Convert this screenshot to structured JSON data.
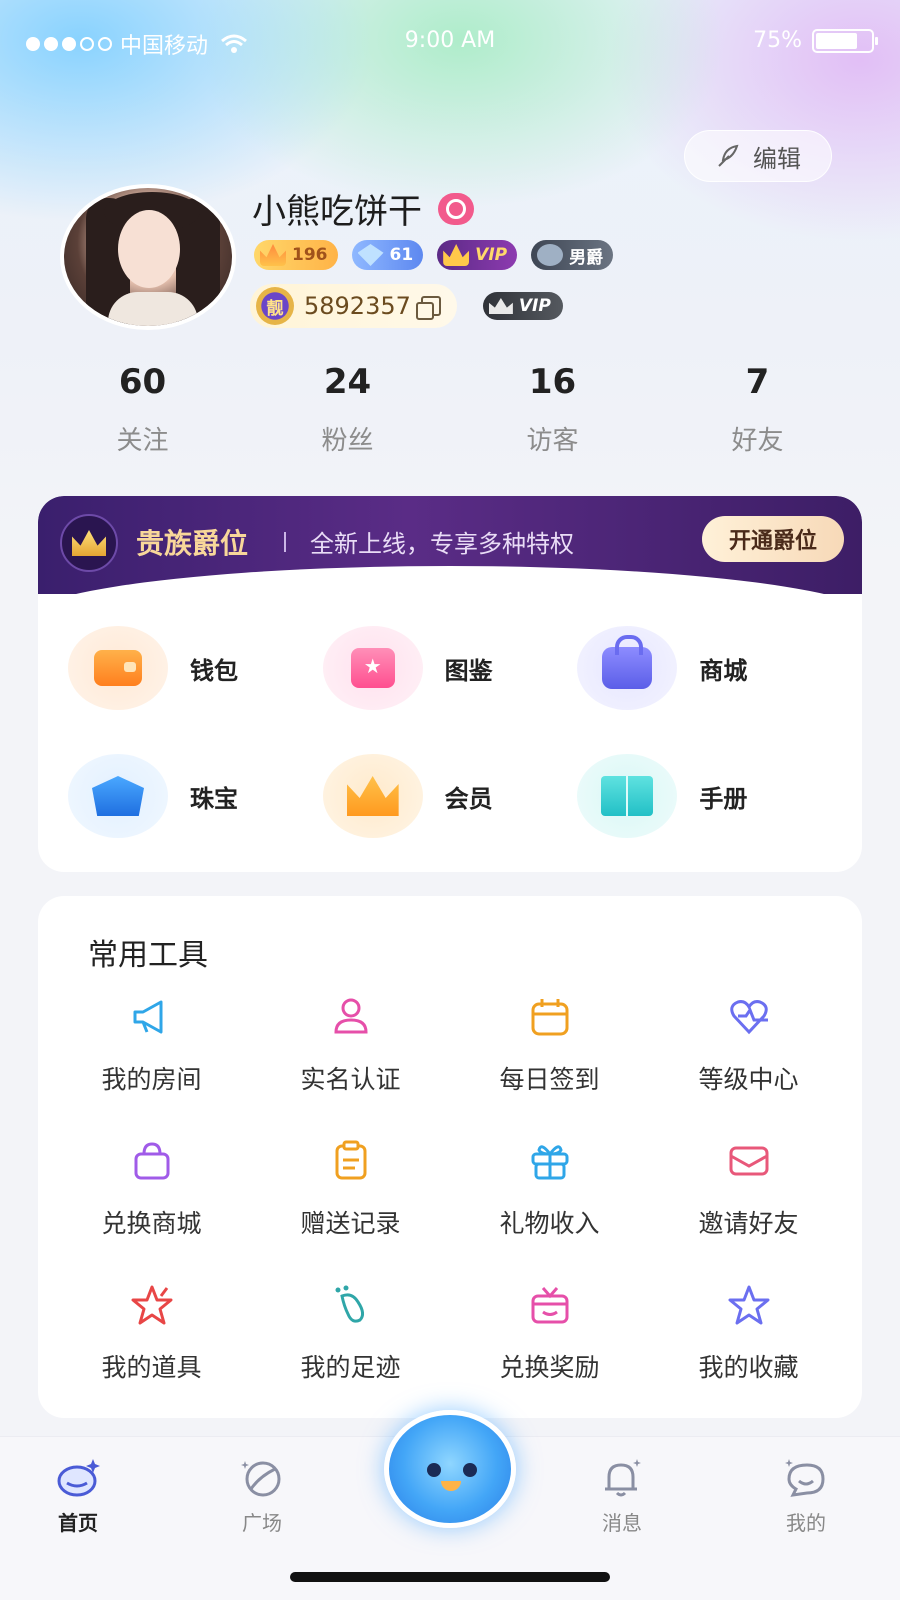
{
  "status_bar": {
    "carrier": "中国移动",
    "time": "9:00 AM",
    "battery": "75%"
  },
  "profile": {
    "edit_label": "编辑",
    "username": "小熊吃饼干",
    "badges": {
      "level": "196",
      "diamond": "61",
      "vip": "VIP",
      "noble": "男爵"
    },
    "id": "5892357",
    "liang_label": "靓",
    "vip2": "VIP"
  },
  "stats": [
    {
      "num": "60",
      "label": "关注"
    },
    {
      "num": "24",
      "label": "粉丝"
    },
    {
      "num": "16",
      "label": "访客"
    },
    {
      "num": "7",
      "label": "好友"
    }
  ],
  "noble": {
    "title": "贵族爵位",
    "subtitle": "全新上线，专享多种特权",
    "button": "开通爵位",
    "items": [
      {
        "label": "钱包",
        "icon": "wallet-icon"
      },
      {
        "label": "图鉴",
        "icon": "gift-box-icon"
      },
      {
        "label": "商城",
        "icon": "shopping-bag-icon"
      },
      {
        "label": "珠宝",
        "icon": "shell-icon"
      },
      {
        "label": "会员",
        "icon": "crown-icon"
      },
      {
        "label": "手册",
        "icon": "book-icon"
      }
    ]
  },
  "tools": {
    "title": "常用工具",
    "items": [
      {
        "label": "我的房间",
        "icon": "megaphone-icon"
      },
      {
        "label": "实名认证",
        "icon": "person-icon"
      },
      {
        "label": "每日签到",
        "icon": "calendar-icon"
      },
      {
        "label": "等级中心",
        "icon": "heart-pulse-icon"
      },
      {
        "label": "兑换商城",
        "icon": "bag-icon"
      },
      {
        "label": "赠送记录",
        "icon": "clipboard-icon"
      },
      {
        "label": "礼物收入",
        "icon": "gift-icon"
      },
      {
        "label": "邀请好友",
        "icon": "envelope-icon"
      },
      {
        "label": "我的道具",
        "icon": "star-burst-icon"
      },
      {
        "label": "我的足迹",
        "icon": "footprint-icon"
      },
      {
        "label": "兑换奖励",
        "icon": "present-box-icon"
      },
      {
        "label": "我的收藏",
        "icon": "star-icon"
      }
    ]
  },
  "tabbar": {
    "home": "首页",
    "square": "广场",
    "messages": "消息",
    "mine": "我的"
  },
  "colors": {
    "tools_icons": [
      "#2fa6e8",
      "#e64fa9",
      "#f0a020",
      "#6b6ff0",
      "#a05be8",
      "#f0a020",
      "#2fa6e8",
      "#e8587a",
      "#e84646",
      "#2fa6a8",
      "#e64fa9",
      "#6b6ff0"
    ]
  }
}
